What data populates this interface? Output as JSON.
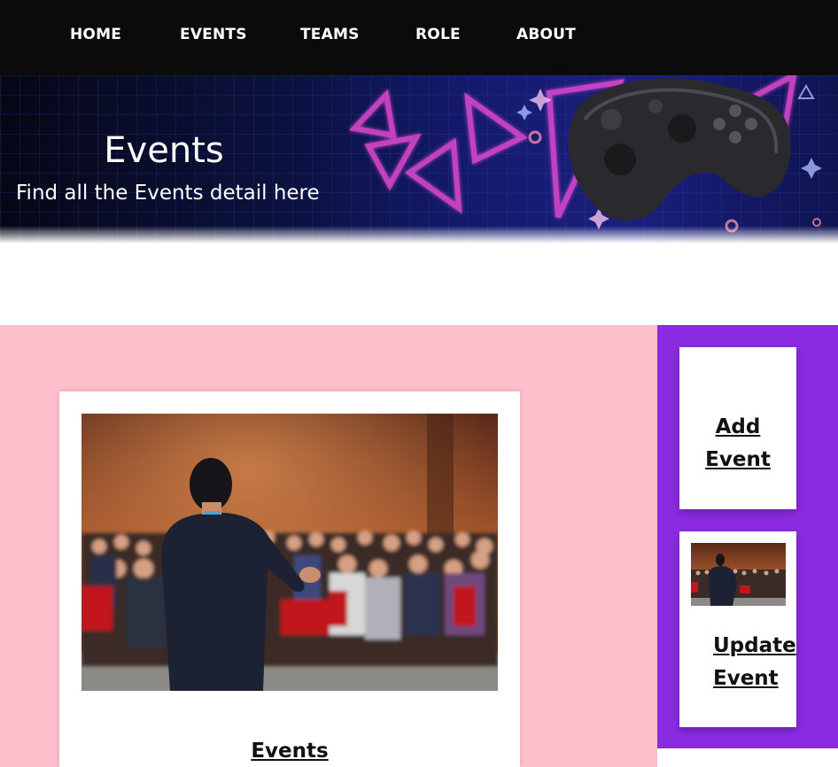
{
  "nav": {
    "items": [
      {
        "label": "HOME"
      },
      {
        "label": "EVENTS"
      },
      {
        "label": "TEAMS"
      },
      {
        "label": "ROLE"
      },
      {
        "label": "ABOUT"
      }
    ]
  },
  "hero": {
    "title": "Events",
    "subtitle": "Find all the Events detail here"
  },
  "main": {
    "card": {
      "link_label": "Events"
    }
  },
  "sidebar": {
    "add": {
      "line1": "Add",
      "line2": "Event"
    },
    "update": {
      "line1": "Update",
      "line2": "Event"
    }
  },
  "colors": {
    "nav_bg": "#0b0b0b",
    "main_bg": "#ffbfcd",
    "sidebar_bg": "#8a2be2"
  }
}
